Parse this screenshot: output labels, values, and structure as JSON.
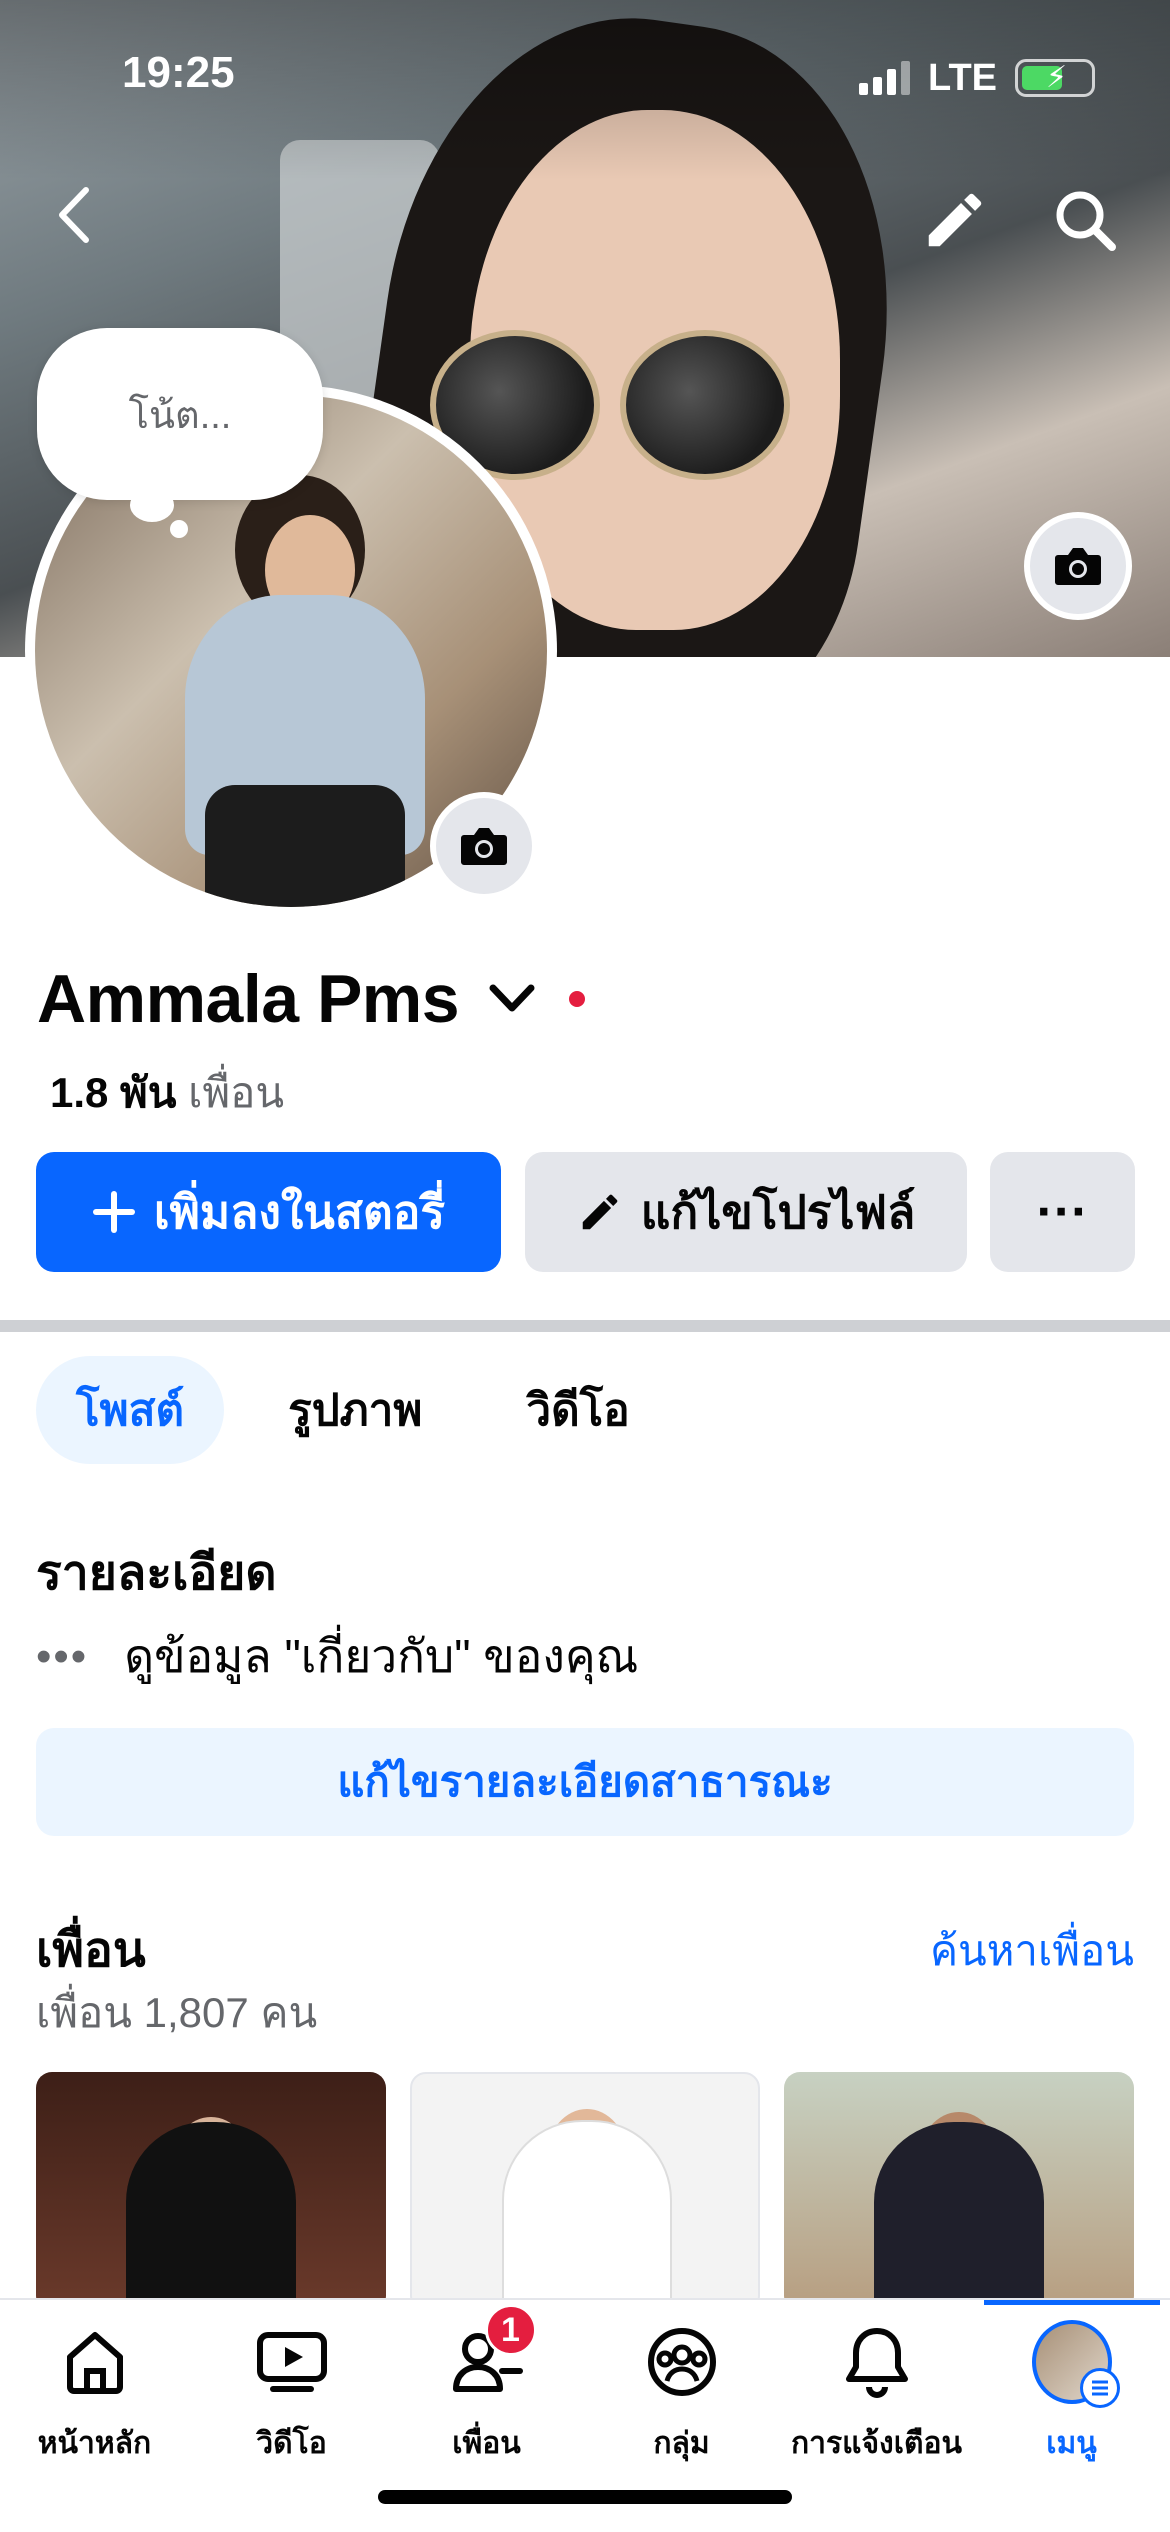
{
  "status_bar": {
    "time": "19:25",
    "network": "LTE",
    "battery_charging": true
  },
  "profile": {
    "note_placeholder": "โน้ต...",
    "name": "Ammala Pms",
    "friends_count_short": "1.8 พัน",
    "friends_word": "เพื่อน"
  },
  "actions": {
    "add_story": "เพิ่มลงในสตอรี่",
    "edit_profile": "แก้ไขโปรไฟล์",
    "more": "···"
  },
  "tabs": [
    {
      "label": "โพสต์",
      "active": true
    },
    {
      "label": "รูปภาพ",
      "active": false
    },
    {
      "label": "วิดีโอ",
      "active": false
    }
  ],
  "details": {
    "title": "รายละเอียด",
    "dots": "•••",
    "about_text": "ดูข้อมูล \"เกี่ยวกับ\" ของคุณ",
    "edit_button": "แก้ไขรายละเอียดสาธารณะ"
  },
  "friends": {
    "title": "เพื่อน",
    "find_link": "ค้นหาเพื่อน",
    "count_text": "เพื่อน 1,807 คน"
  },
  "tabbar": {
    "items": [
      {
        "label": "หน้าหลัก",
        "icon": "home-icon"
      },
      {
        "label": "วิดีโอ",
        "icon": "video-icon"
      },
      {
        "label": "เพื่อน",
        "icon": "friends-icon",
        "badge": "1"
      },
      {
        "label": "กลุ่ม",
        "icon": "groups-icon"
      },
      {
        "label": "การแจ้งเตือน",
        "icon": "bell-icon"
      },
      {
        "label": "เมนู",
        "icon": "menu-avatar",
        "active": true
      }
    ]
  },
  "colors": {
    "accent": "#0866ff",
    "badge": "#e41e3f",
    "button_gray": "#e4e6eb",
    "muted_text": "#65676b"
  }
}
